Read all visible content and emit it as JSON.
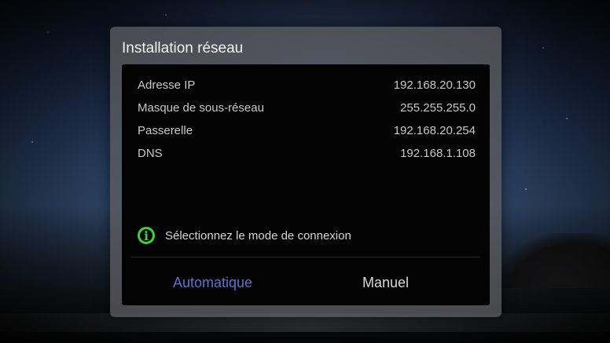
{
  "dialog": {
    "title": "Installation réseau",
    "rows": [
      {
        "label": "Adresse IP",
        "value": "192.168.20.130"
      },
      {
        "label": "Masque de sous-réseau",
        "value": "255.255.255.0"
      },
      {
        "label": "Passerelle",
        "value": "192.168.20.254"
      },
      {
        "label": "DNS",
        "value": "192.168.1.108"
      }
    ],
    "info": {
      "icon": "info-icon",
      "text": "Sélectionnez le mode de connexion"
    },
    "buttons": {
      "automatic": "Automatique",
      "manual": "Manuel"
    }
  },
  "colors": {
    "selected_option": "#5f73c9",
    "info_icon": "#3ed13a"
  }
}
